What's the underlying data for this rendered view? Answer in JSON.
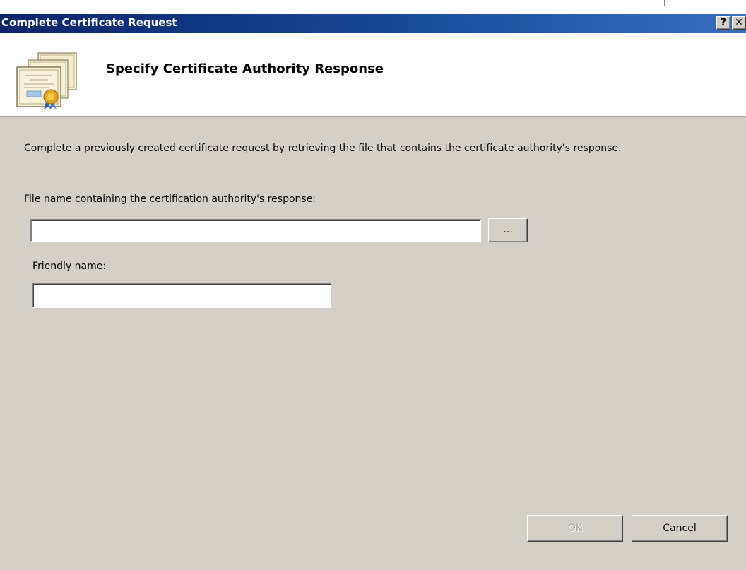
{
  "window": {
    "title": "Complete Certificate Request",
    "help_glyph": "?",
    "close_glyph": "✕"
  },
  "header": {
    "title": "Specify Certificate Authority Response",
    "icon": "certificate-icon"
  },
  "body": {
    "description": "Complete a previously created certificate request by retrieving the file that contains the certificate authority's response.",
    "file_label": "File name containing the certification authority's response:",
    "file_value": "",
    "browse_label": "...",
    "friendly_label": "Friendly name:",
    "friendly_value": ""
  },
  "footer": {
    "ok_label": "OK",
    "cancel_label": "Cancel",
    "ok_enabled": false
  }
}
